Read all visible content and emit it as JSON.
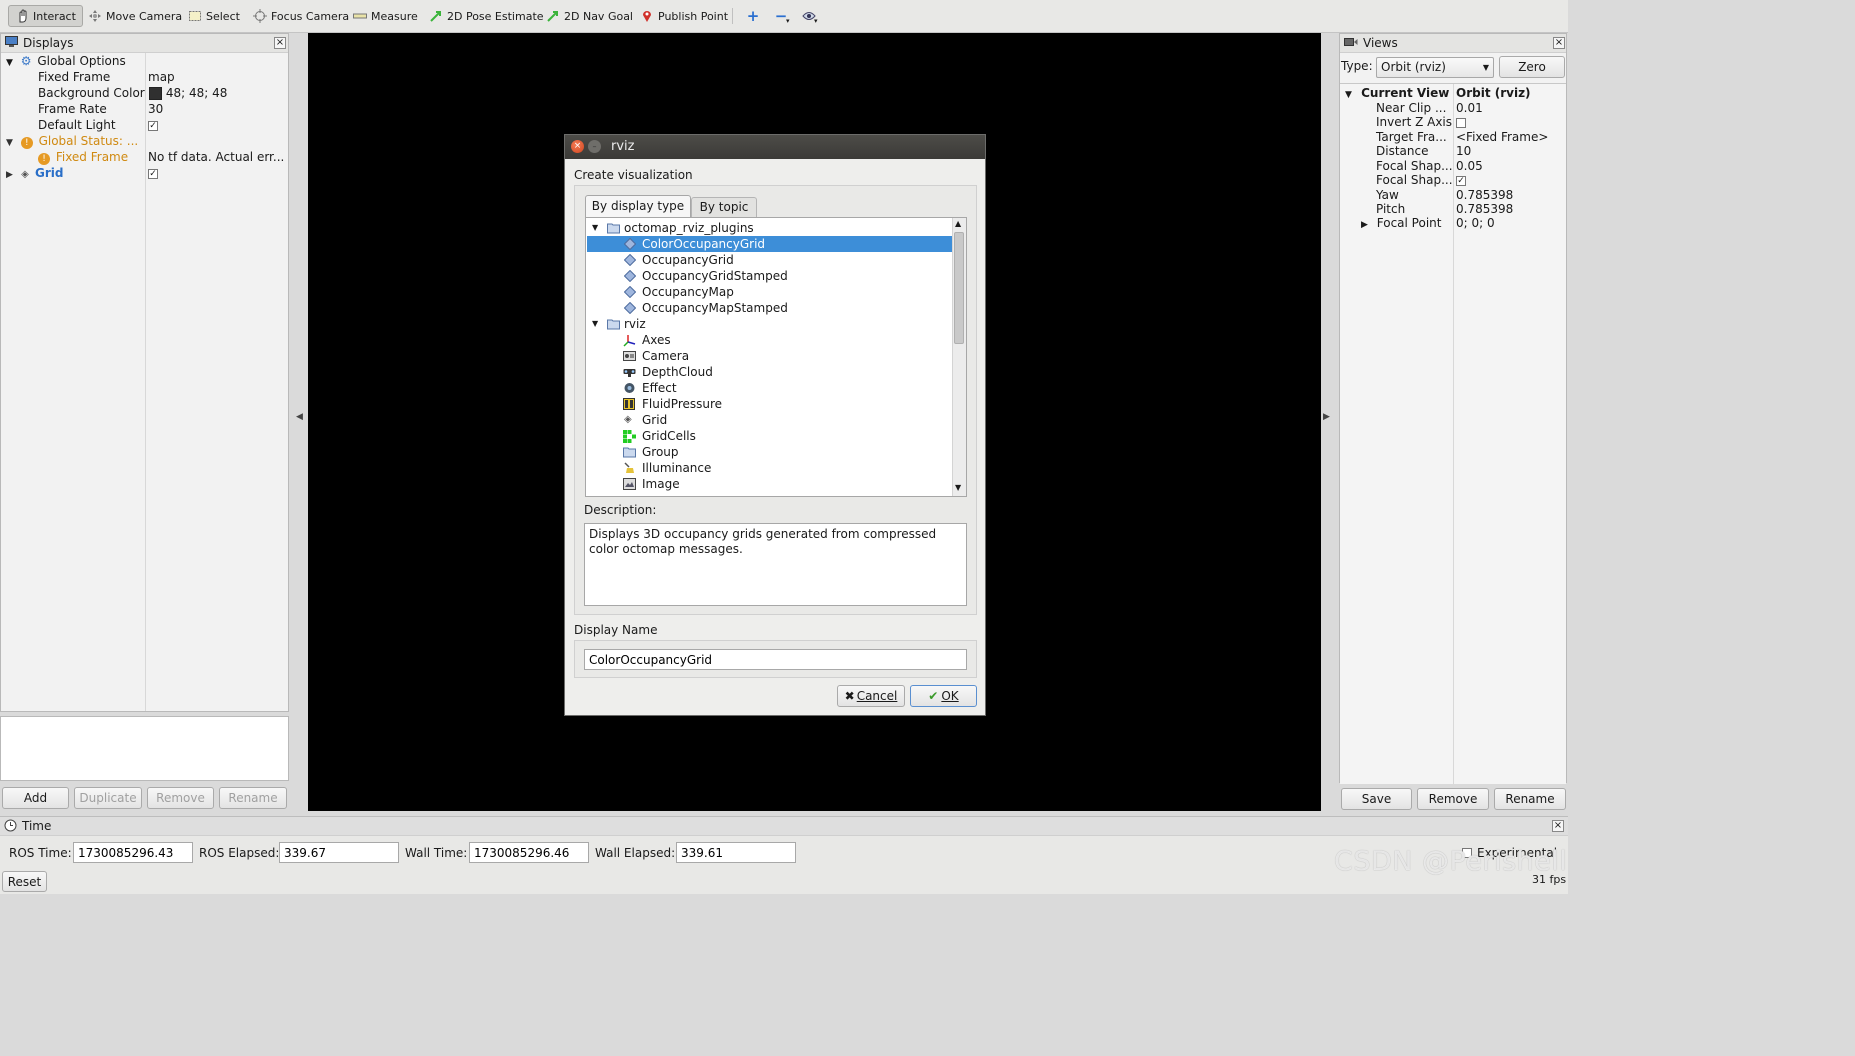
{
  "toolbar": {
    "tools": [
      {
        "label": "Interact",
        "icon": "hand-icon"
      },
      {
        "label": "Move Camera",
        "icon": "move-camera-icon"
      },
      {
        "label": "Select",
        "icon": "select-icon"
      },
      {
        "label": "Focus Camera",
        "icon": "focus-camera-icon"
      },
      {
        "label": "Measure",
        "icon": "measure-icon"
      },
      {
        "label": "2D Pose Estimate",
        "icon": "pose-arrow-icon"
      },
      {
        "label": "2D Nav Goal",
        "icon": "nav-arrow-icon"
      },
      {
        "label": "Publish Point",
        "icon": "map-pin-icon"
      }
    ],
    "active_tool": "Interact"
  },
  "displays": {
    "title": "Displays",
    "tree": [
      {
        "name": "Global Options",
        "value": ""
      },
      {
        "name": "Fixed Frame",
        "value": "map"
      },
      {
        "name": "Background Color",
        "value": "48; 48; 48"
      },
      {
        "name": "Frame Rate",
        "value": "30"
      },
      {
        "name": "Default Light",
        "value": "✓"
      },
      {
        "name": "Global Status: ...",
        "value": ""
      },
      {
        "name": "Fixed Frame",
        "value": "No tf data.  Actual err..."
      },
      {
        "name": "Grid",
        "value": "✓"
      }
    ],
    "buttons": {
      "add": "Add",
      "duplicate": "Duplicate",
      "remove": "Remove",
      "rename": "Rename"
    }
  },
  "views": {
    "title": "Views",
    "type_label": "Type:",
    "type_value": "Orbit (rviz)",
    "zero_label": "Zero",
    "current_view": {
      "name": "Current View",
      "value": "Orbit (rviz)"
    },
    "props": [
      {
        "name": "Near Clip ...",
        "value": "0.01"
      },
      {
        "name": "Invert Z Axis",
        "value": ""
      },
      {
        "name": "Target Fra...",
        "value": "<Fixed Frame>"
      },
      {
        "name": "Distance",
        "value": "10"
      },
      {
        "name": "Focal Shap...",
        "value": "0.05"
      },
      {
        "name": "Focal Shap...",
        "value": "✓"
      },
      {
        "name": "Yaw",
        "value": "0.785398"
      },
      {
        "name": "Pitch",
        "value": "0.785398"
      },
      {
        "name": "Focal Point",
        "value": "0; 0; 0"
      }
    ],
    "buttons": {
      "save": "Save",
      "remove": "Remove",
      "rename": "Rename"
    }
  },
  "time": {
    "title": "Time",
    "ros_time_label": "ROS Time:",
    "ros_time": "1730085296.43",
    "ros_elapsed_label": "ROS Elapsed:",
    "ros_elapsed": "339.67",
    "wall_time_label": "Wall Time:",
    "wall_time": "1730085296.46",
    "wall_elapsed_label": "Wall Elapsed:",
    "wall_elapsed": "339.61",
    "experimental_label": "Experimental",
    "reset_label": "Reset",
    "fps": "31 fps"
  },
  "dialog": {
    "title": "rviz",
    "heading": "Create visualization",
    "tabs": [
      "By display type",
      "By topic"
    ],
    "active_tab": "By display type",
    "groups": [
      {
        "name": "octomap_rviz_plugins",
        "items": [
          "ColorOccupancyGrid",
          "OccupancyGrid",
          "OccupancyGridStamped",
          "OccupancyMap",
          "OccupancyMapStamped"
        ]
      },
      {
        "name": "rviz",
        "items": [
          "Axes",
          "Camera",
          "DepthCloud",
          "Effect",
          "FluidPressure",
          "Grid",
          "GridCells",
          "Group",
          "Illuminance",
          "Image"
        ]
      }
    ],
    "selected_item": "ColorOccupancyGrid",
    "description_label": "Description:",
    "description": "Displays 3D occupancy grids generated from compressed color octomap messages.",
    "display_name_label": "Display Name",
    "display_name": "ColorOccupancyGrid",
    "cancel_label": "Cancel",
    "ok_label": "OK"
  },
  "watermark": "CSDN @Perishell"
}
